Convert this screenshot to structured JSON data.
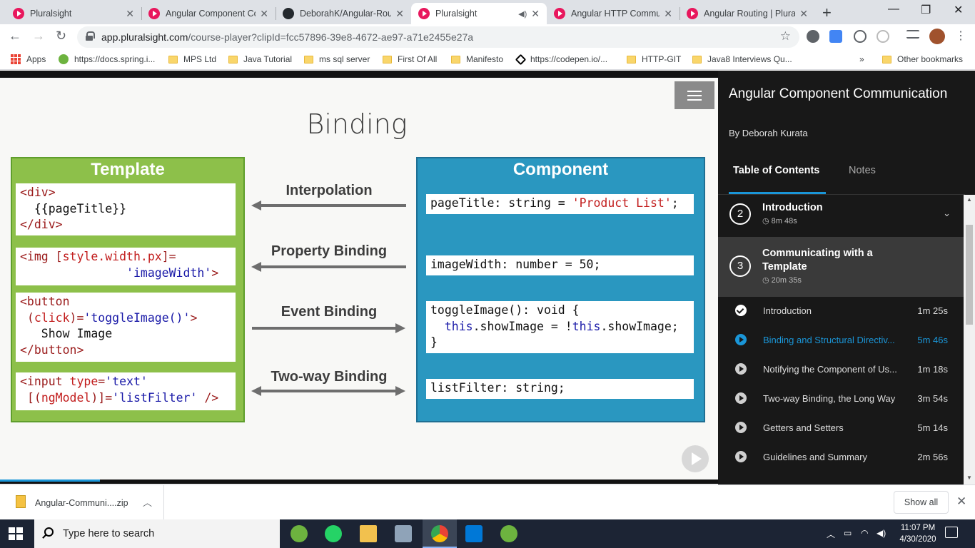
{
  "tabs": [
    {
      "title": "Pluralsight"
    },
    {
      "title": "Angular Component Co"
    },
    {
      "title": "DeborahK/Angular-Rou"
    },
    {
      "title": "Pluralsight"
    },
    {
      "title": "Angular HTTP Commun"
    },
    {
      "title": "Angular Routing | Plura"
    }
  ],
  "address": {
    "domain": "app.pluralsight.com",
    "path": "/course-player?clipId=fcc57896-39e8-4672-ae97-a71e2455e27a"
  },
  "bookmarks": [
    "Apps",
    "https://docs.spring.i...",
    "MPS Ltd",
    "Java Tutorial",
    "ms sql server",
    "First Of All",
    "Manifesto",
    "https://codepen.io/...",
    "HTTP-GIT",
    "Java8 Interviews Qu..."
  ],
  "other_bookmarks": "Other bookmarks",
  "bm_more": "»",
  "slide": {
    "title": "Binding",
    "template_header": "Template",
    "component_header": "Component",
    "bindings": [
      "Interpolation",
      "Property Binding",
      "Event Binding",
      "Two-way Binding"
    ]
  },
  "course": {
    "title": "Angular Component Communication",
    "author": "By Deborah Kurata",
    "tab_toc": "Table of Contents",
    "tab_notes": "Notes",
    "modules": [
      {
        "num": "2",
        "title": "Introduction",
        "duration": "8m 48s"
      },
      {
        "num": "3",
        "title": "Communicating with a Template",
        "duration": "20m 35s"
      }
    ],
    "clips": [
      {
        "title": "Introduction",
        "duration": "1m 25s",
        "state": "done"
      },
      {
        "title": "Binding and Structural Directiv...",
        "duration": "5m 46s",
        "state": "current"
      },
      {
        "title": "Notifying the Component of Us...",
        "duration": "1m 18s",
        "state": "todo"
      },
      {
        "title": "Two-way Binding, the Long Way",
        "duration": "3m 54s",
        "state": "todo"
      },
      {
        "title": "Getters and Setters",
        "duration": "5m 14s",
        "state": "todo"
      },
      {
        "title": "Guidelines and Summary",
        "duration": "2m 56s",
        "state": "todo"
      }
    ]
  },
  "download": {
    "name": "Angular-Communi....zip",
    "show_all": "Show all"
  },
  "taskbar": {
    "search_placeholder": "Type here to search",
    "time": "11:07 PM",
    "date": "4/30/2020"
  }
}
